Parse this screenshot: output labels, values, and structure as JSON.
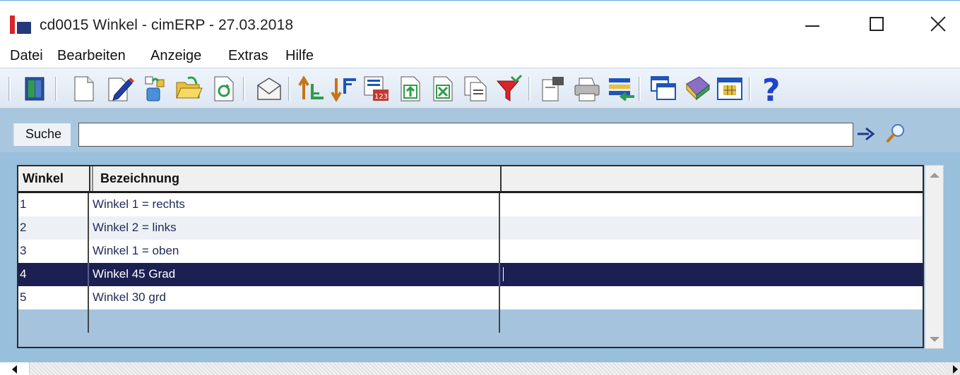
{
  "window": {
    "title": "cd0015 Winkel - cimERP - 27.03.2018",
    "controls": {
      "minimize": "minimize-icon",
      "maximize": "maximize-icon",
      "close": "close-icon"
    }
  },
  "menu": [
    "Datei",
    "Bearbeiten",
    "Anzeige",
    "Extras",
    "Hilfe"
  ],
  "toolbar": {
    "icons": [
      "exit-door-icon",
      "new-document-icon",
      "edit-pencil-icon",
      "copy-record-icon",
      "open-folder-icon",
      "refresh-icon",
      "mail-envelope-icon",
      "sort-ascending-icon",
      "sort-descending-icon",
      "number-sequence-icon",
      "export-icon",
      "excel-export-icon",
      "copy-pages-icon",
      "filter-funnel-icon",
      "paste-icon",
      "printer-icon",
      "transfer-list-icon",
      "windows-icon",
      "book-icon",
      "calendar-grid-icon",
      "help-icon"
    ]
  },
  "search": {
    "label": "Suche",
    "value": "",
    "go_icon": "arrow-right-icon",
    "magnifier_icon": "magnifier-icon"
  },
  "grid": {
    "columns": [
      "Winkel",
      "Bezeichnung",
      ""
    ],
    "rows": [
      {
        "winkel": "1",
        "bezeichnung": "Winkel 1 = rechts",
        "extra": ""
      },
      {
        "winkel": "2",
        "bezeichnung": "Winkel 2 = links",
        "extra": ""
      },
      {
        "winkel": "3",
        "bezeichnung": "Winkel 1 = oben",
        "extra": ""
      },
      {
        "winkel": "4",
        "bezeichnung": "Winkel 45 Grad",
        "extra": ""
      },
      {
        "winkel": "5",
        "bezeichnung": "Winkel 30 grd",
        "extra": ""
      }
    ],
    "selected_row_index": 3
  },
  "colors": {
    "selected_row": "#1c1f52",
    "grid_background": "#a5c3dd",
    "search_strip": "#a8c6de",
    "brand_red": "#d8242b",
    "brand_blue": "#233a78"
  }
}
